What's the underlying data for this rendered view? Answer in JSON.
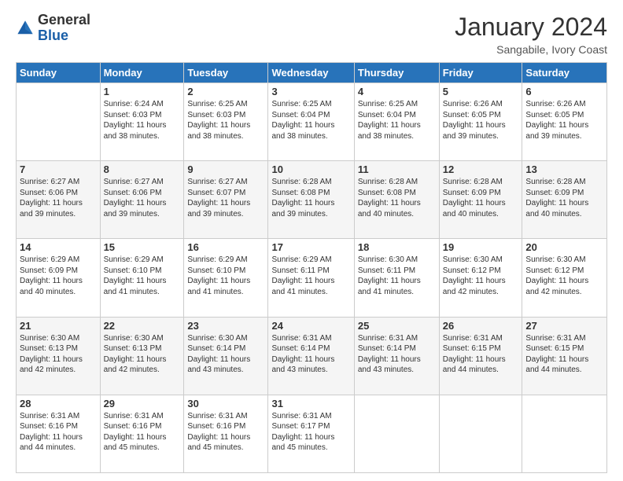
{
  "logo": {
    "general": "General",
    "blue": "Blue"
  },
  "header": {
    "month_year": "January 2024",
    "location": "Sangabile, Ivory Coast"
  },
  "weekdays": [
    "Sunday",
    "Monday",
    "Tuesday",
    "Wednesday",
    "Thursday",
    "Friday",
    "Saturday"
  ],
  "weeks": [
    [
      {
        "day": "",
        "info": ""
      },
      {
        "day": "1",
        "info": "Sunrise: 6:24 AM\nSunset: 6:03 PM\nDaylight: 11 hours\nand 38 minutes."
      },
      {
        "day": "2",
        "info": "Sunrise: 6:25 AM\nSunset: 6:03 PM\nDaylight: 11 hours\nand 38 minutes."
      },
      {
        "day": "3",
        "info": "Sunrise: 6:25 AM\nSunset: 6:04 PM\nDaylight: 11 hours\nand 38 minutes."
      },
      {
        "day": "4",
        "info": "Sunrise: 6:25 AM\nSunset: 6:04 PM\nDaylight: 11 hours\nand 38 minutes."
      },
      {
        "day": "5",
        "info": "Sunrise: 6:26 AM\nSunset: 6:05 PM\nDaylight: 11 hours\nand 39 minutes."
      },
      {
        "day": "6",
        "info": "Sunrise: 6:26 AM\nSunset: 6:05 PM\nDaylight: 11 hours\nand 39 minutes."
      }
    ],
    [
      {
        "day": "7",
        "info": "Sunrise: 6:27 AM\nSunset: 6:06 PM\nDaylight: 11 hours\nand 39 minutes."
      },
      {
        "day": "8",
        "info": "Sunrise: 6:27 AM\nSunset: 6:06 PM\nDaylight: 11 hours\nand 39 minutes."
      },
      {
        "day": "9",
        "info": "Sunrise: 6:27 AM\nSunset: 6:07 PM\nDaylight: 11 hours\nand 39 minutes."
      },
      {
        "day": "10",
        "info": "Sunrise: 6:28 AM\nSunset: 6:08 PM\nDaylight: 11 hours\nand 39 minutes."
      },
      {
        "day": "11",
        "info": "Sunrise: 6:28 AM\nSunset: 6:08 PM\nDaylight: 11 hours\nand 40 minutes."
      },
      {
        "day": "12",
        "info": "Sunrise: 6:28 AM\nSunset: 6:09 PM\nDaylight: 11 hours\nand 40 minutes."
      },
      {
        "day": "13",
        "info": "Sunrise: 6:28 AM\nSunset: 6:09 PM\nDaylight: 11 hours\nand 40 minutes."
      }
    ],
    [
      {
        "day": "14",
        "info": "Sunrise: 6:29 AM\nSunset: 6:09 PM\nDaylight: 11 hours\nand 40 minutes."
      },
      {
        "day": "15",
        "info": "Sunrise: 6:29 AM\nSunset: 6:10 PM\nDaylight: 11 hours\nand 41 minutes."
      },
      {
        "day": "16",
        "info": "Sunrise: 6:29 AM\nSunset: 6:10 PM\nDaylight: 11 hours\nand 41 minutes."
      },
      {
        "day": "17",
        "info": "Sunrise: 6:29 AM\nSunset: 6:11 PM\nDaylight: 11 hours\nand 41 minutes."
      },
      {
        "day": "18",
        "info": "Sunrise: 6:30 AM\nSunset: 6:11 PM\nDaylight: 11 hours\nand 41 minutes."
      },
      {
        "day": "19",
        "info": "Sunrise: 6:30 AM\nSunset: 6:12 PM\nDaylight: 11 hours\nand 42 minutes."
      },
      {
        "day": "20",
        "info": "Sunrise: 6:30 AM\nSunset: 6:12 PM\nDaylight: 11 hours\nand 42 minutes."
      }
    ],
    [
      {
        "day": "21",
        "info": "Sunrise: 6:30 AM\nSunset: 6:13 PM\nDaylight: 11 hours\nand 42 minutes."
      },
      {
        "day": "22",
        "info": "Sunrise: 6:30 AM\nSunset: 6:13 PM\nDaylight: 11 hours\nand 42 minutes."
      },
      {
        "day": "23",
        "info": "Sunrise: 6:30 AM\nSunset: 6:14 PM\nDaylight: 11 hours\nand 43 minutes."
      },
      {
        "day": "24",
        "info": "Sunrise: 6:31 AM\nSunset: 6:14 PM\nDaylight: 11 hours\nand 43 minutes."
      },
      {
        "day": "25",
        "info": "Sunrise: 6:31 AM\nSunset: 6:14 PM\nDaylight: 11 hours\nand 43 minutes."
      },
      {
        "day": "26",
        "info": "Sunrise: 6:31 AM\nSunset: 6:15 PM\nDaylight: 11 hours\nand 44 minutes."
      },
      {
        "day": "27",
        "info": "Sunrise: 6:31 AM\nSunset: 6:15 PM\nDaylight: 11 hours\nand 44 minutes."
      }
    ],
    [
      {
        "day": "28",
        "info": "Sunrise: 6:31 AM\nSunset: 6:16 PM\nDaylight: 11 hours\nand 44 minutes."
      },
      {
        "day": "29",
        "info": "Sunrise: 6:31 AM\nSunset: 6:16 PM\nDaylight: 11 hours\nand 45 minutes."
      },
      {
        "day": "30",
        "info": "Sunrise: 6:31 AM\nSunset: 6:16 PM\nDaylight: 11 hours\nand 45 minutes."
      },
      {
        "day": "31",
        "info": "Sunrise: 6:31 AM\nSunset: 6:17 PM\nDaylight: 11 hours\nand 45 minutes."
      },
      {
        "day": "",
        "info": ""
      },
      {
        "day": "",
        "info": ""
      },
      {
        "day": "",
        "info": ""
      }
    ]
  ]
}
